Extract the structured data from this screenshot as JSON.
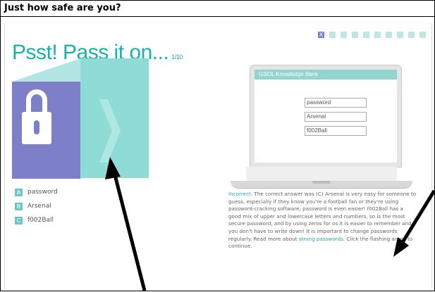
{
  "window": {
    "title": "Just how safe are you?"
  },
  "quiz": {
    "heading": "Psst! Pass it on...",
    "counter": "1/10",
    "progress": [
      {
        "label": "X",
        "state": "incorrect"
      },
      {
        "label": "",
        "state": "pending"
      },
      {
        "label": "",
        "state": "pending"
      },
      {
        "label": "",
        "state": "pending"
      },
      {
        "label": "",
        "state": "pending"
      },
      {
        "label": "",
        "state": "pending"
      },
      {
        "label": "",
        "state": "pending"
      },
      {
        "label": "",
        "state": "pending"
      },
      {
        "label": "",
        "state": "pending"
      },
      {
        "label": "",
        "state": "pending"
      }
    ],
    "answers": [
      {
        "letter": "A",
        "text": "password"
      },
      {
        "letter": "B",
        "text": "Arsenal"
      },
      {
        "letter": "C",
        "text": "f002Ball"
      }
    ]
  },
  "laptop": {
    "bank_title": "GSOL Knowledge Bank",
    "fields": [
      "password",
      "Arsenal",
      "f002Ball"
    ]
  },
  "explanation": {
    "incorrect": "Incorrect.",
    "body_1": " The correct answer was (C) Arsenal is very easy for someone to guess, especially if they know you're a football fan or they're using password-cracking software; password is even easier! f002Ball has a good mix of upper and lowercase letters and numbers, so is the most secure password, and by using zeros for os it is easier to remember and you don't have to write down! It is important to change passwords regularly. Read more about ",
    "link": "strong passwords",
    "body_2": ". Click the flashing arrow to continue."
  },
  "colors": {
    "teal": "#18b0ad",
    "purple": "#7d7fc8",
    "light_teal": "#8fdcd6"
  }
}
